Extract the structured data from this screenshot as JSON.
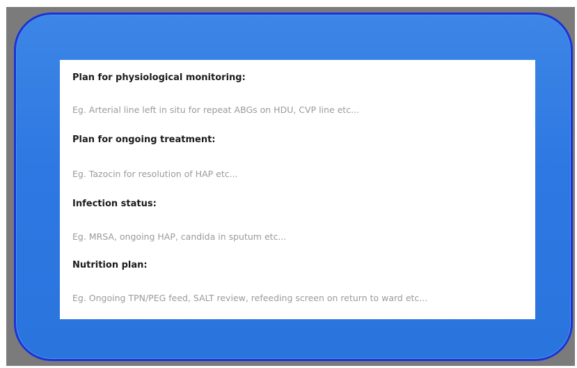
{
  "sections": [
    {
      "heading": "Plan for physiological monitoring:",
      "placeholder": "Eg. Arterial line left in situ for repeat ABGs on HDU, CVP line etc..."
    },
    {
      "heading": "Plan for ongoing treatment:",
      "placeholder": "Eg. Tazocin for resolution of HAP etc..."
    },
    {
      "heading": "Infection status:",
      "placeholder": "Eg. MRSA, ongoing HAP, candida in sputum etc..."
    },
    {
      "heading": "Nutrition plan:",
      "placeholder": "Eg. Ongoing TPN/PEG feed, SALT review, refeeding screen on return to ward etc..."
    }
  ],
  "colors": {
    "frame_fill": "#2d78e2",
    "frame_border": "#1b33d6",
    "backdrop": "#7b7b7b",
    "heading_text": "#1b1b1b",
    "placeholder_text": "#9a9a9a"
  }
}
